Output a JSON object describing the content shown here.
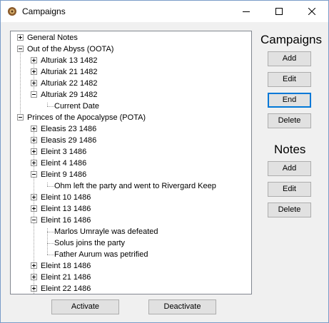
{
  "window": {
    "title": "Campaigns"
  },
  "tree": {
    "items": [
      {
        "label": "General Notes"
      },
      {
        "label": "Out of the Abyss (OOTA)"
      },
      {
        "label": "Alturiak 13 1482"
      },
      {
        "label": "Alturiak 21 1482"
      },
      {
        "label": "Alturiak 22 1482"
      },
      {
        "label": "Alturiak 29 1482"
      },
      {
        "label": "Current Date"
      },
      {
        "label": "Princes of the Apocalypse (POTA)"
      },
      {
        "label": "Eleasis 23 1486"
      },
      {
        "label": "Eleasis 29 1486"
      },
      {
        "label": "Eleint 3 1486"
      },
      {
        "label": "Eleint 4 1486"
      },
      {
        "label": "Eleint 9 1486"
      },
      {
        "label": "Ohm left the party and went to Rivergard Keep"
      },
      {
        "label": "Eleint 10 1486"
      },
      {
        "label": "Eleint 13 1486"
      },
      {
        "label": "Eleint 16 1486"
      },
      {
        "label": "Marlos Umrayle was defeated"
      },
      {
        "label": "Solus joins the party"
      },
      {
        "label": "Father Aurum was petrified"
      },
      {
        "label": "Eleint 18 1486"
      },
      {
        "label": "Eleint 21 1486"
      },
      {
        "label": "Eleint 22 1486"
      }
    ]
  },
  "campaigns": {
    "title": "Campaigns",
    "add": "Add",
    "edit": "Edit",
    "end": "End",
    "delete": "Delete"
  },
  "notes": {
    "title": "Notes",
    "add": "Add",
    "edit": "Edit",
    "delete": "Delete"
  },
  "bottom": {
    "activate": "Activate",
    "deactivate": "Deactivate"
  }
}
